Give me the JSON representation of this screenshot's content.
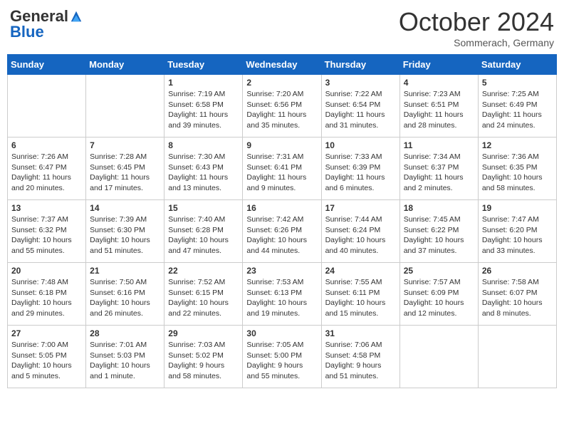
{
  "logo": {
    "general": "General",
    "blue": "Blue"
  },
  "title": "October 2024",
  "subtitle": "Sommerach, Germany",
  "days_of_week": [
    "Sunday",
    "Monday",
    "Tuesday",
    "Wednesday",
    "Thursday",
    "Friday",
    "Saturday"
  ],
  "weeks": [
    [
      {
        "day": "",
        "info": ""
      },
      {
        "day": "",
        "info": ""
      },
      {
        "day": "1",
        "info": "Sunrise: 7:19 AM\nSunset: 6:58 PM\nDaylight: 11 hours and 39 minutes."
      },
      {
        "day": "2",
        "info": "Sunrise: 7:20 AM\nSunset: 6:56 PM\nDaylight: 11 hours and 35 minutes."
      },
      {
        "day": "3",
        "info": "Sunrise: 7:22 AM\nSunset: 6:54 PM\nDaylight: 11 hours and 31 minutes."
      },
      {
        "day": "4",
        "info": "Sunrise: 7:23 AM\nSunset: 6:51 PM\nDaylight: 11 hours and 28 minutes."
      },
      {
        "day": "5",
        "info": "Sunrise: 7:25 AM\nSunset: 6:49 PM\nDaylight: 11 hours and 24 minutes."
      }
    ],
    [
      {
        "day": "6",
        "info": "Sunrise: 7:26 AM\nSunset: 6:47 PM\nDaylight: 11 hours and 20 minutes."
      },
      {
        "day": "7",
        "info": "Sunrise: 7:28 AM\nSunset: 6:45 PM\nDaylight: 11 hours and 17 minutes."
      },
      {
        "day": "8",
        "info": "Sunrise: 7:30 AM\nSunset: 6:43 PM\nDaylight: 11 hours and 13 minutes."
      },
      {
        "day": "9",
        "info": "Sunrise: 7:31 AM\nSunset: 6:41 PM\nDaylight: 11 hours and 9 minutes."
      },
      {
        "day": "10",
        "info": "Sunrise: 7:33 AM\nSunset: 6:39 PM\nDaylight: 11 hours and 6 minutes."
      },
      {
        "day": "11",
        "info": "Sunrise: 7:34 AM\nSunset: 6:37 PM\nDaylight: 11 hours and 2 minutes."
      },
      {
        "day": "12",
        "info": "Sunrise: 7:36 AM\nSunset: 6:35 PM\nDaylight: 10 hours and 58 minutes."
      }
    ],
    [
      {
        "day": "13",
        "info": "Sunrise: 7:37 AM\nSunset: 6:32 PM\nDaylight: 10 hours and 55 minutes."
      },
      {
        "day": "14",
        "info": "Sunrise: 7:39 AM\nSunset: 6:30 PM\nDaylight: 10 hours and 51 minutes."
      },
      {
        "day": "15",
        "info": "Sunrise: 7:40 AM\nSunset: 6:28 PM\nDaylight: 10 hours and 47 minutes."
      },
      {
        "day": "16",
        "info": "Sunrise: 7:42 AM\nSunset: 6:26 PM\nDaylight: 10 hours and 44 minutes."
      },
      {
        "day": "17",
        "info": "Sunrise: 7:44 AM\nSunset: 6:24 PM\nDaylight: 10 hours and 40 minutes."
      },
      {
        "day": "18",
        "info": "Sunrise: 7:45 AM\nSunset: 6:22 PM\nDaylight: 10 hours and 37 minutes."
      },
      {
        "day": "19",
        "info": "Sunrise: 7:47 AM\nSunset: 6:20 PM\nDaylight: 10 hours and 33 minutes."
      }
    ],
    [
      {
        "day": "20",
        "info": "Sunrise: 7:48 AM\nSunset: 6:18 PM\nDaylight: 10 hours and 29 minutes."
      },
      {
        "day": "21",
        "info": "Sunrise: 7:50 AM\nSunset: 6:16 PM\nDaylight: 10 hours and 26 minutes."
      },
      {
        "day": "22",
        "info": "Sunrise: 7:52 AM\nSunset: 6:15 PM\nDaylight: 10 hours and 22 minutes."
      },
      {
        "day": "23",
        "info": "Sunrise: 7:53 AM\nSunset: 6:13 PM\nDaylight: 10 hours and 19 minutes."
      },
      {
        "day": "24",
        "info": "Sunrise: 7:55 AM\nSunset: 6:11 PM\nDaylight: 10 hours and 15 minutes."
      },
      {
        "day": "25",
        "info": "Sunrise: 7:57 AM\nSunset: 6:09 PM\nDaylight: 10 hours and 12 minutes."
      },
      {
        "day": "26",
        "info": "Sunrise: 7:58 AM\nSunset: 6:07 PM\nDaylight: 10 hours and 8 minutes."
      }
    ],
    [
      {
        "day": "27",
        "info": "Sunrise: 7:00 AM\nSunset: 5:05 PM\nDaylight: 10 hours and 5 minutes."
      },
      {
        "day": "28",
        "info": "Sunrise: 7:01 AM\nSunset: 5:03 PM\nDaylight: 10 hours and 1 minute."
      },
      {
        "day": "29",
        "info": "Sunrise: 7:03 AM\nSunset: 5:02 PM\nDaylight: 9 hours and 58 minutes."
      },
      {
        "day": "30",
        "info": "Sunrise: 7:05 AM\nSunset: 5:00 PM\nDaylight: 9 hours and 55 minutes."
      },
      {
        "day": "31",
        "info": "Sunrise: 7:06 AM\nSunset: 4:58 PM\nDaylight: 9 hours and 51 minutes."
      },
      {
        "day": "",
        "info": ""
      },
      {
        "day": "",
        "info": ""
      }
    ]
  ]
}
